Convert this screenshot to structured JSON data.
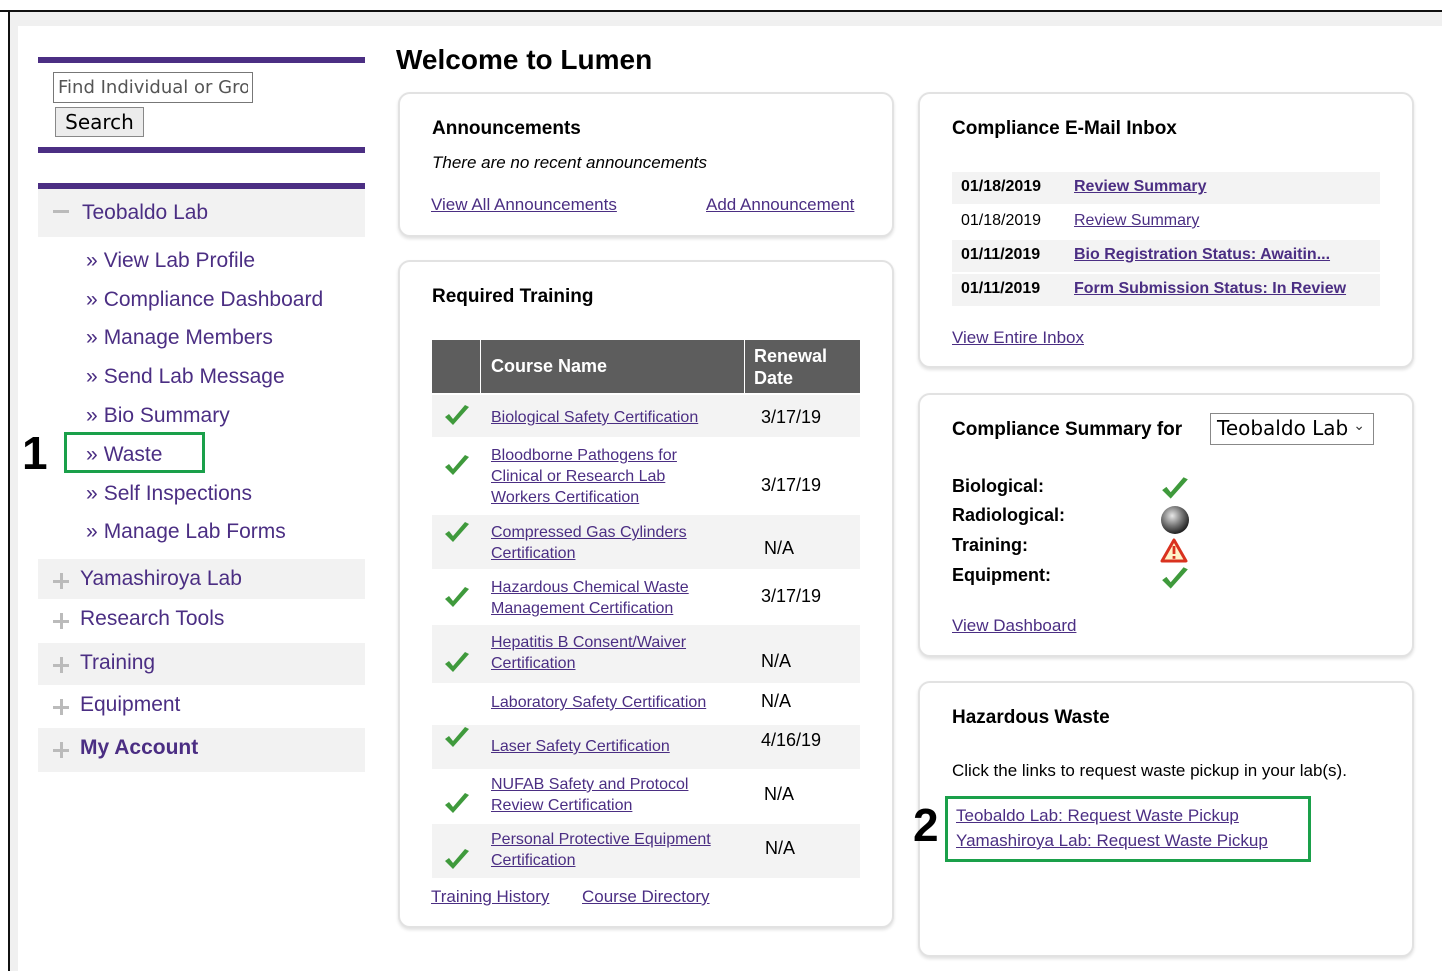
{
  "search": {
    "placeholder": "Find Individual or Grou",
    "button": "Search"
  },
  "nav": {
    "lab": "Teobaldo Lab",
    "items": [
      "View Lab Profile",
      "Compliance Dashboard",
      "Manage Members",
      "Send Lab Message",
      "Bio Summary",
      "Waste",
      "Self Inspections",
      "Manage Lab Forms"
    ],
    "collapsed": [
      "Yamashiroya Lab",
      "Research Tools",
      "Training",
      "Equipment",
      "My Account"
    ],
    "bullet": "»"
  },
  "annotations": {
    "one": "1",
    "two": "2"
  },
  "page_title": "Welcome to Lumen",
  "announcements": {
    "title": "Announcements",
    "empty": "There are no recent announcements",
    "view_all": "View All Announcements",
    "add": "Add Announcement"
  },
  "training": {
    "title": "Required Training",
    "col_course": "Course Name",
    "col_date": "Renewal Date",
    "rows": [
      {
        "course": "Biological Safety Certification",
        "date": "3/17/19",
        "done": true
      },
      {
        "course": "Bloodborne Pathogens for Clinical or Research Lab Workers Certification",
        "date": "3/17/19",
        "done": true
      },
      {
        "course": "Compressed Gas Cylinders Certification",
        "date": "N/A",
        "done": true
      },
      {
        "course": "Hazardous Chemical Waste Management Certification",
        "date": "3/17/19",
        "done": true
      },
      {
        "course": "Hepatitis B Consent/Waiver Certification",
        "date": "N/A",
        "done": true
      },
      {
        "course": "Laboratory Safety Certification",
        "date": "N/A",
        "done": false
      },
      {
        "course": "Laser Safety Certification",
        "date": "4/16/19",
        "done": true
      },
      {
        "course": "NUFAB Safety and Protocol Review Certification",
        "date": "N/A",
        "done": true
      },
      {
        "course": "Personal Protective Equipment Certification",
        "date": "N/A",
        "done": true
      }
    ],
    "history": "Training History",
    "directory": "Course Directory"
  },
  "inbox": {
    "title": "Compliance E-Mail Inbox",
    "rows": [
      {
        "date": "01/18/2019",
        "subject": "Review Summary",
        "unread": true
      },
      {
        "date": "01/18/2019",
        "subject": "Review Summary",
        "unread": false
      },
      {
        "date": "01/11/2019",
        "subject": "Bio Registration Status: Awaitin...",
        "unread": true
      },
      {
        "date": "01/11/2019",
        "subject": "Form Submission Status: In Review",
        "unread": true
      }
    ],
    "view_all": "View Entire Inbox"
  },
  "compliance": {
    "title": "Compliance Summary for",
    "selected": "Teobaldo Lab",
    "items": [
      {
        "label": "Biological:",
        "status": "check-icon"
      },
      {
        "label": "Radiological:",
        "status": "gray-sphere-icon"
      },
      {
        "label": "Training:",
        "status": "warning-icon"
      },
      {
        "label": "Equipment:",
        "status": "check-icon"
      }
    ],
    "view_dashboard": "View Dashboard"
  },
  "waste": {
    "title": "Hazardous Waste",
    "instructions": "Click the links to request waste pickup in your lab(s).",
    "links": [
      "Teobaldo Lab: Request Waste Pickup",
      "Yamashiroya Lab: Request Waste Pickup"
    ]
  },
  "colors": {
    "brand": "#4b2e83",
    "annotation": "#1aa04a",
    "check": "#3f9a3c"
  }
}
